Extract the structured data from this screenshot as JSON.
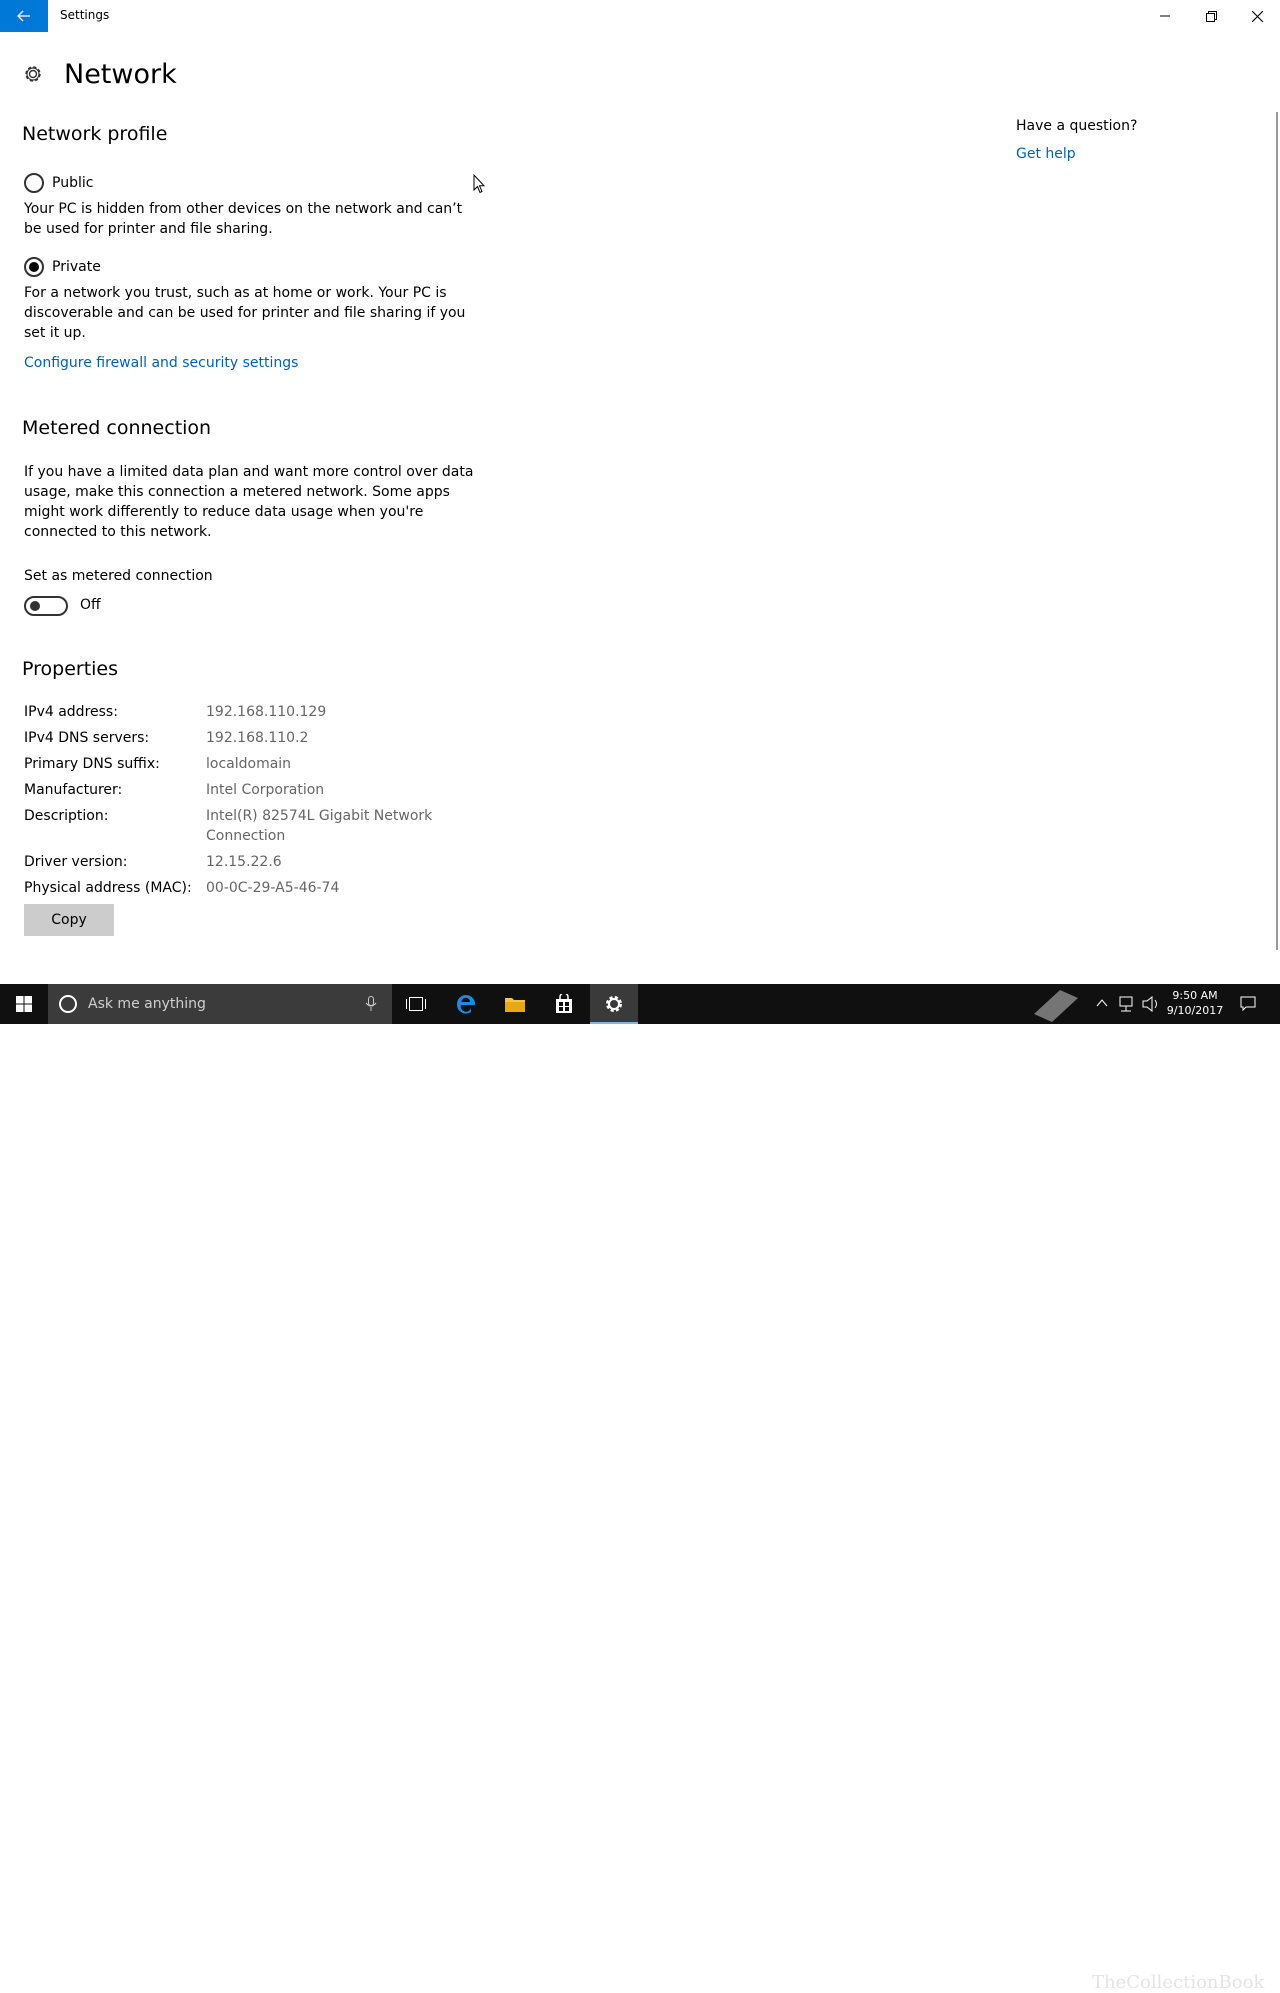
{
  "window": {
    "title": "Settings"
  },
  "page": {
    "title": "Network"
  },
  "network_profile": {
    "heading": "Network profile",
    "public": {
      "label": "Public",
      "selected": false,
      "description": "Your PC is hidden from other devices on the network and can’t be used for printer and file sharing."
    },
    "private": {
      "label": "Private",
      "selected": true,
      "description": "For a network you trust, such as at home or work. Your PC is discoverable and can be used for printer and file sharing if you set it up."
    },
    "firewall_link": "Configure firewall and security settings"
  },
  "metered": {
    "heading": "Metered connection",
    "description": "If you have a limited data plan and want more control over data usage, make this connection a metered network. Some apps might work differently to reduce data usage when you're connected to this network.",
    "toggle_label": "Set as metered connection",
    "toggle_state": "Off"
  },
  "properties": {
    "heading": "Properties",
    "ipv4_label": "IPv4 address:",
    "ipv4_value": "192.168.110.129",
    "dns_label": "IPv4 DNS servers:",
    "dns_value": "192.168.110.2",
    "suffix_label": "Primary DNS suffix:",
    "suffix_value": "localdomain",
    "manufacturer_label": "Manufacturer:",
    "manufacturer_value": "Intel Corporation",
    "description_label": "Description:",
    "description_value": "Intel(R) 82574L Gigabit Network Connection",
    "driver_label": "Driver version:",
    "driver_value": "12.15.22.6",
    "mac_label": "Physical address (MAC):",
    "mac_value": "00-0C-29-A5-46-74",
    "copy_button": "Copy"
  },
  "sidebar": {
    "question": "Have a question?",
    "help_link": "Get help"
  },
  "taskbar": {
    "search_placeholder": "Ask me anything",
    "time": "9:50 AM",
    "date": "9/10/2017",
    "watermark": "TheCollectionBook"
  },
  "colors": {
    "accent": "#0078d7",
    "link": "#0063b1",
    "taskbar": "#101010"
  }
}
